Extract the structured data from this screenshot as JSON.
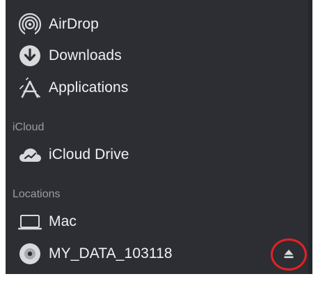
{
  "favorites": [
    {
      "label": "AirDrop",
      "icon": "airdrop-icon"
    },
    {
      "label": "Downloads",
      "icon": "downloads-icon"
    },
    {
      "label": "Applications",
      "icon": "applications-icon"
    }
  ],
  "icloud": {
    "section_label": "iCloud",
    "items": [
      {
        "label": "iCloud Drive",
        "icon": "icloud-icon"
      }
    ]
  },
  "locations": {
    "section_label": "Locations",
    "items": [
      {
        "label": "Mac",
        "icon": "laptop-icon"
      },
      {
        "label": "MY_DATA_103118",
        "icon": "disk-icon",
        "eject_icon": "eject-icon"
      }
    ]
  },
  "colors": {
    "sidebar_bg": "#2d2e33",
    "text": "#f1f1f3",
    "section_text": "#9b9ca3",
    "highlight_ring": "#e32226"
  }
}
